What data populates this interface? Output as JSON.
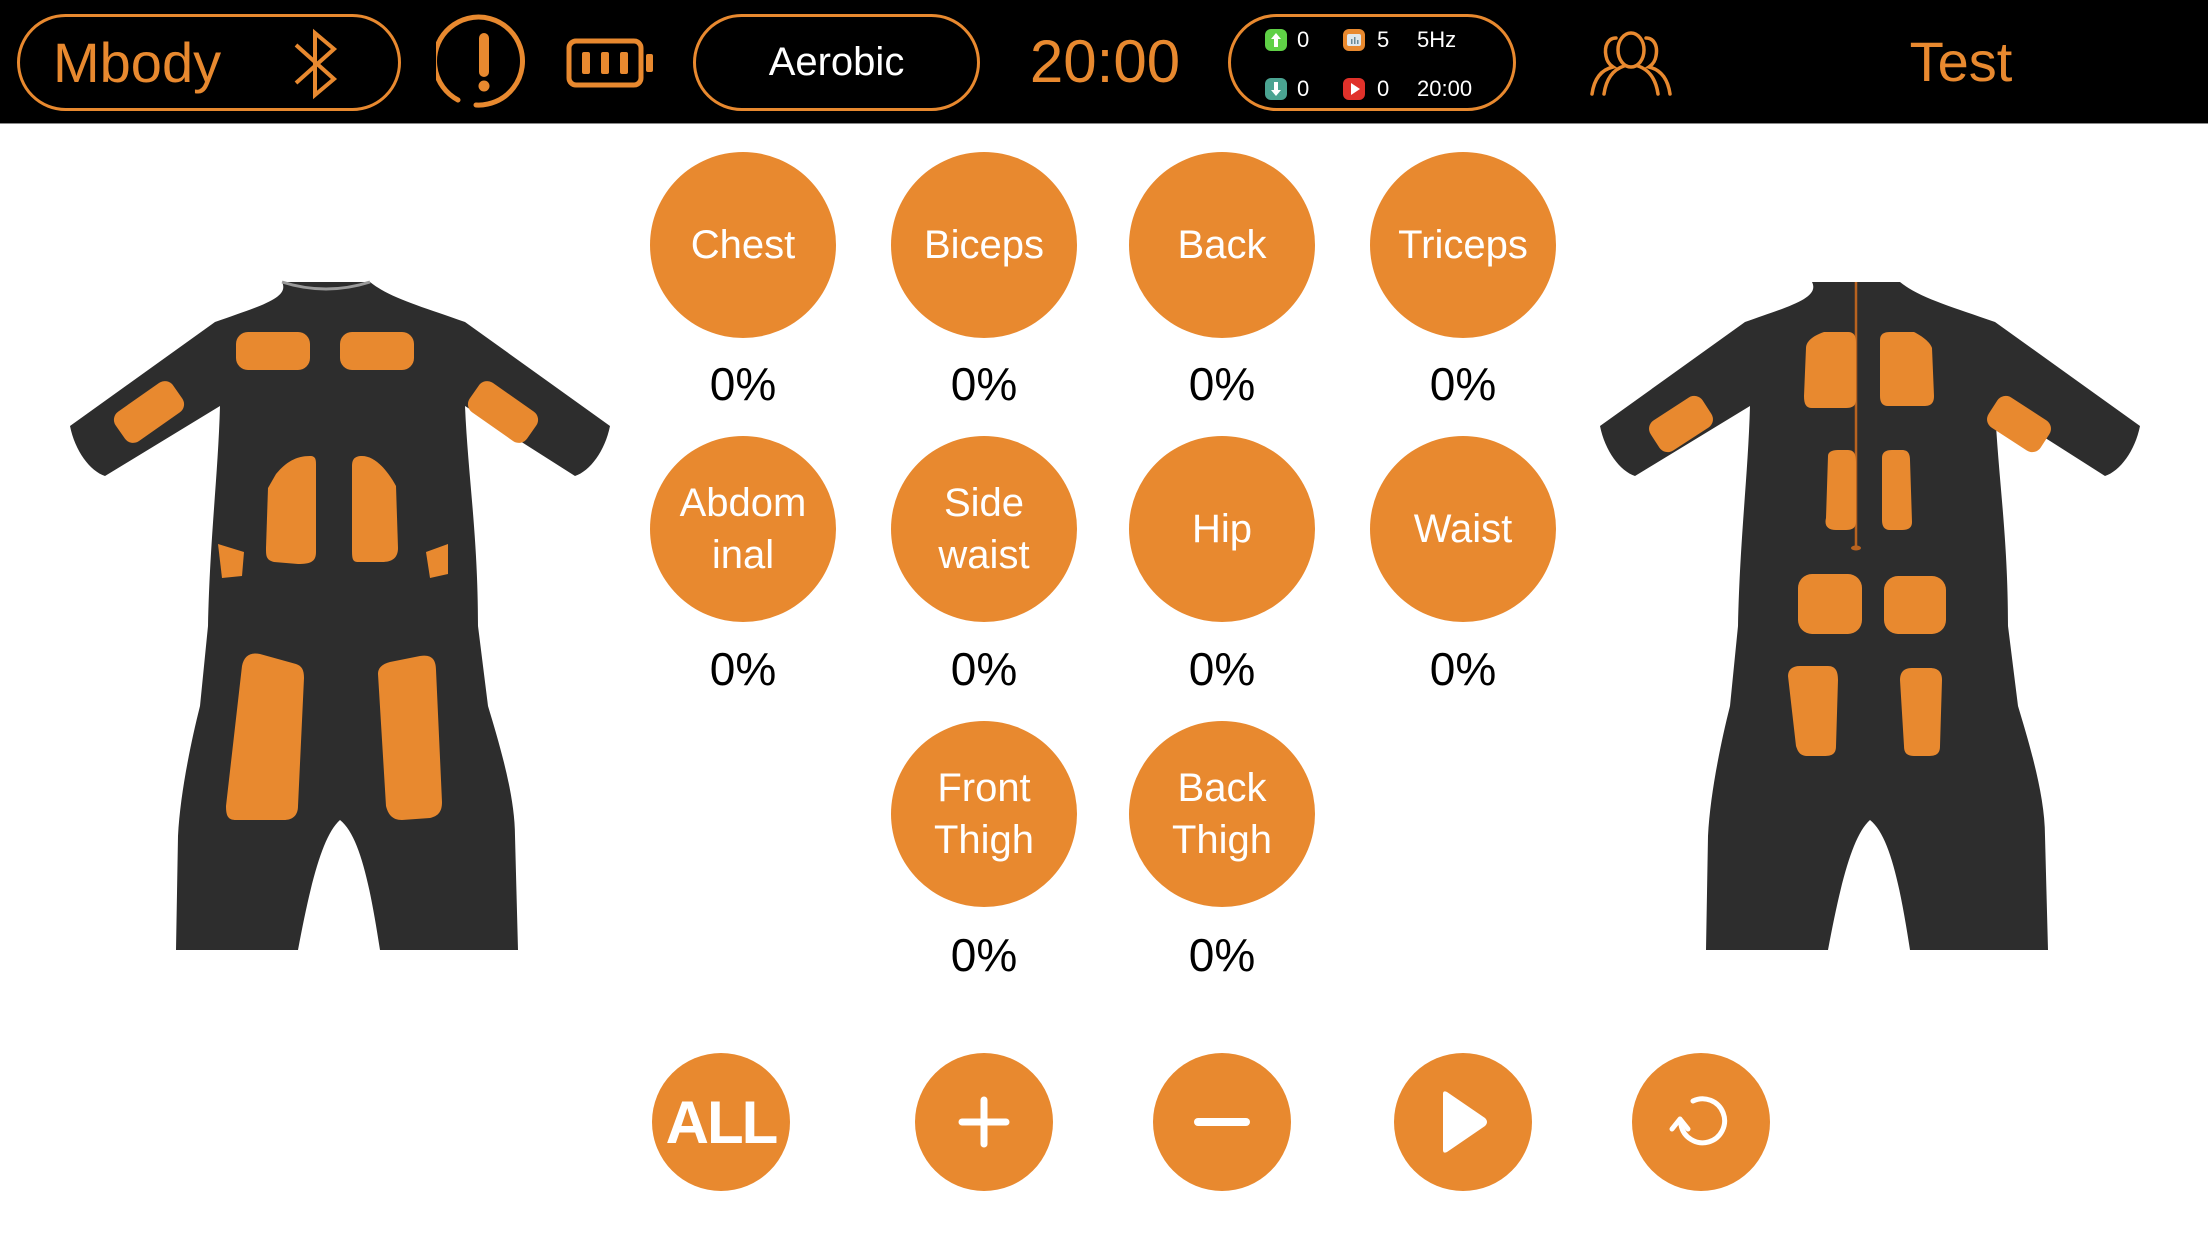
{
  "header": {
    "brand": "Mbody",
    "bluetooth_icon": "bluetooth-icon",
    "alert_icon": "exclamation-circle-icon",
    "battery_icon": "battery-icon",
    "mode": "Aerobic",
    "timer": "20:00",
    "stats": {
      "up_count": "0",
      "down_count": "0",
      "program_count": "5",
      "play_count": "0",
      "frequency": "5Hz",
      "duration": "20:00"
    },
    "group_icon": "users-group-icon",
    "user_name": "Test"
  },
  "colors": {
    "accent": "#e8892f",
    "header_bg": "#000000",
    "suit": "#2d2d2d",
    "badge_up": "#5fd046",
    "badge_down": "#4aa391",
    "badge_program": "#e8892f",
    "badge_play": "#e0312a"
  },
  "zones": [
    {
      "label": "Chest",
      "value": "0%"
    },
    {
      "label": "Biceps",
      "value": "0%"
    },
    {
      "label": "Back",
      "value": "0%"
    },
    {
      "label": "Triceps",
      "value": "0%"
    },
    {
      "label": "Abdom\ninal",
      "value": "0%"
    },
    {
      "label": "Side\nwaist",
      "value": "0%"
    },
    {
      "label": "Hip",
      "value": "0%"
    },
    {
      "label": "Waist",
      "value": "0%"
    },
    {
      "label": "Front\nThigh",
      "value": "0%"
    },
    {
      "label": "Back\nThigh",
      "value": "0%"
    }
  ],
  "controls": {
    "all_label": "ALL",
    "plus_icon": "plus-icon",
    "minus_icon": "minus-icon",
    "play_icon": "play-icon",
    "reset_icon": "reset-icon"
  },
  "figures": {
    "front": "suit-front-view",
    "back": "suit-back-view"
  }
}
